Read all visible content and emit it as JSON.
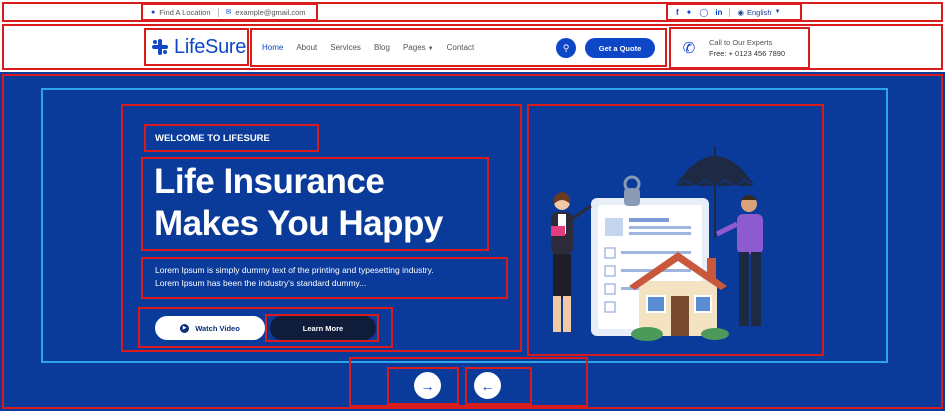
{
  "topbar": {
    "location": "Find A Location",
    "email": "example@gmail.com",
    "social": [
      "f",
      "t",
      "ig",
      "in"
    ],
    "language": "English"
  },
  "header": {
    "logo": "LifeSure",
    "nav": [
      {
        "label": "Home",
        "active": true
      },
      {
        "label": "About",
        "active": false
      },
      {
        "label": "Services",
        "active": false
      },
      {
        "label": "Blog",
        "active": false
      },
      {
        "label": "Pages",
        "active": false,
        "dropdown": true
      },
      {
        "label": "Contact",
        "active": false
      }
    ],
    "quote_button": "Get a Quote",
    "call_label": "Call to Our Experts",
    "call_number": "Free: + 0123 456 7890"
  },
  "hero": {
    "kicker": "WELCOME TO LIFESURE",
    "headline_line1": "Life Insurance",
    "headline_line2": "Makes You Happy",
    "description_line1": "Lorem Ipsum is simply dummy text of the printing and typesetting industry.",
    "description_line2": "Lorem Ipsum has been the industry's standard dummy...",
    "watch_button": "Watch Video",
    "learn_button": "Learn More"
  },
  "carousel": {
    "next_symbol": "→",
    "prev_symbol": "←"
  },
  "colors": {
    "primary": "#0d47c8",
    "hero_bg": "#0a3a9a",
    "annotation": "#d81b1b"
  }
}
